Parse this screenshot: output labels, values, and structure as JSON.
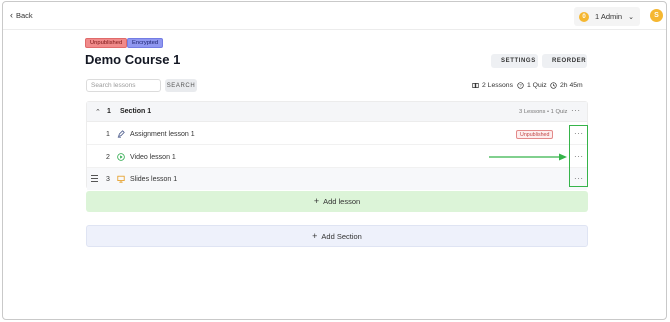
{
  "topbar": {
    "back_label": "Back",
    "admin": {
      "coin_label": "0",
      "label": "1 Admin"
    },
    "avatar_initial": "S"
  },
  "course": {
    "badges": [
      "Unpublished",
      "Encrypted"
    ],
    "title": "Demo Course 1",
    "settings_label": "SETTINGS",
    "reorder_label": "REORDER"
  },
  "search": {
    "placeholder": "Search lessons",
    "button_label": "SEARCH"
  },
  "stats": {
    "lessons": "2 Lessons",
    "quiz": "1 Quiz",
    "duration": "2h 45m"
  },
  "section": {
    "number": "1",
    "title": "Section 1",
    "meta": "3 Lessons • 1 Quiz",
    "lessons": [
      {
        "number": "1",
        "title": "Assignment lesson 1",
        "icon": "pencil-icon",
        "badge": "Unpublished"
      },
      {
        "number": "2",
        "title": "Video lesson 1",
        "icon": "play-icon",
        "badge": ""
      },
      {
        "number": "3",
        "title": "Slides lesson 1",
        "icon": "slides-icon",
        "badge": ""
      }
    ]
  },
  "add_lesson_label": "Add lesson",
  "add_section_label": "Add Section",
  "colors": {
    "accent_green": "#36b44a",
    "unpublished_badge": "#f08a8a",
    "encrypted_badge": "#8f97f0",
    "add_lesson_bg": "#dcf4d8",
    "add_section_bg": "#eef1fb",
    "coin": "#f5b731"
  }
}
